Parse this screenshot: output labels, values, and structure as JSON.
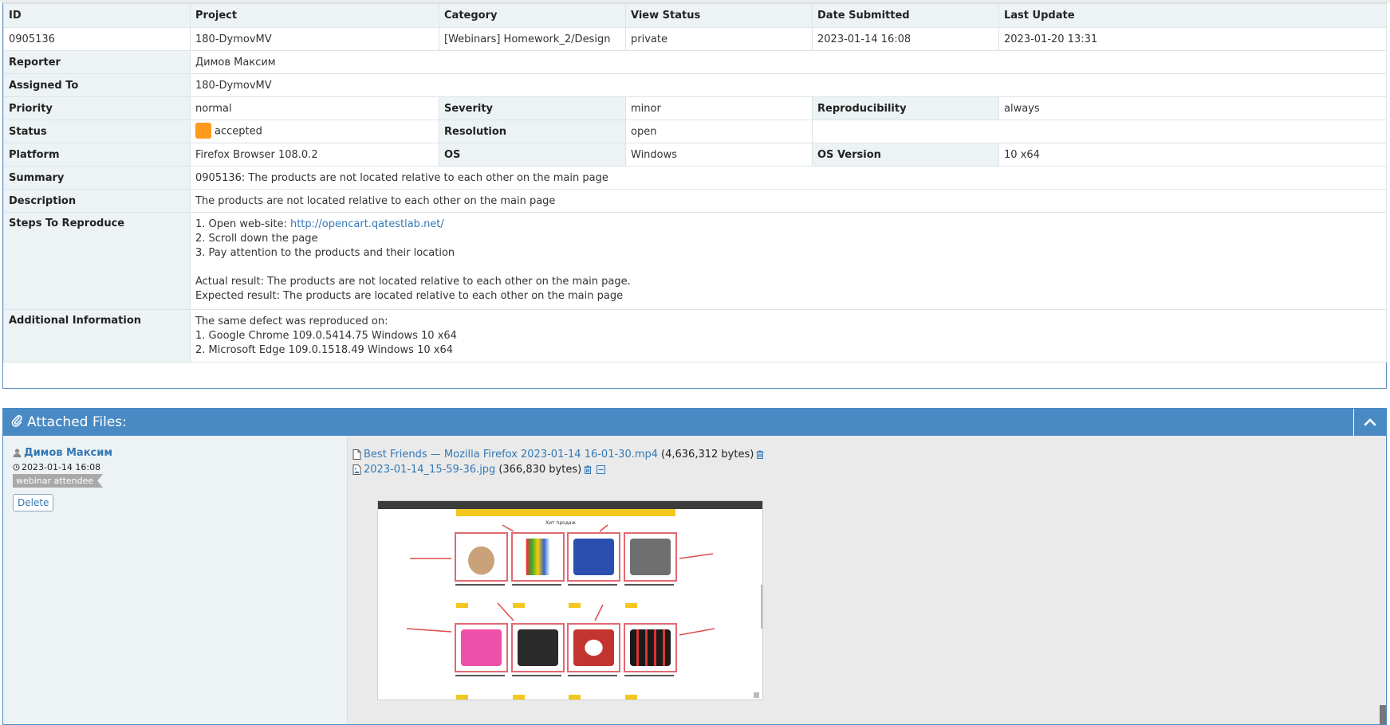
{
  "header": {
    "id_label": "ID",
    "project_label": "Project",
    "category_label": "Category",
    "view_status_label": "View Status",
    "date_submitted_label": "Date Submitted",
    "last_update_label": "Last Update"
  },
  "issue": {
    "id": "0905136",
    "project": "180-DymovMV",
    "category": "[Webinars] Homework_2/Design",
    "view_status": "private",
    "date_submitted": "2023-01-14 16:08",
    "last_update": "2023-01-20 13:31",
    "reporter_label": "Reporter",
    "reporter": "Димов Максим",
    "assigned_label": "Assigned To",
    "assigned_to": "180-DymovMV",
    "priority_label": "Priority",
    "priority": "normal",
    "severity_label": "Severity",
    "severity": "minor",
    "reproducibility_label": "Reproducibility",
    "reproducibility": "always",
    "status_label": "Status",
    "status": "accepted",
    "status_color": "#ff9a1f",
    "resolution_label": "Resolution",
    "resolution": "open",
    "platform_label": "Platform",
    "platform": "Firefox Browser 108.0.2",
    "os_label": "OS",
    "os": "Windows",
    "os_version_label": "OS Version",
    "os_version": "10 x64",
    "summary_label": "Summary",
    "summary": "0905136: The products are not located relative to each other on the main page",
    "description_label": "Description",
    "description": "The products are not located relative to each other on the main page",
    "steps_label": "Steps To Reproduce",
    "steps": {
      "step1_prefix": "1. Open web-site: ",
      "step1_link": "http://opencart.qatestlab.net/",
      "step2": "2. Scroll down the page",
      "step3": "3. Pay attention to the products and their location",
      "actual": "Actual result: The products are not located relative to each other on the main page.",
      "expected": "Expected result: The products are located relative to each other on the main page"
    },
    "additional_label": "Additional Information",
    "additional": {
      "line1": "The same defect was reproduced on:",
      "line2": "1. Google Chrome 109.0.5414.75 Windows 10 x64",
      "line3": "2. Microsoft Edge 109.0.1518.49 Windows 10 x64"
    }
  },
  "attachments": {
    "title": "Attached Files:",
    "author": "Димов Максим",
    "date": "2023-01-14 16:08",
    "tag": "webinar attendee",
    "delete_label": "Delete",
    "files": [
      {
        "name": "Best Friends — Mozilla Firefox 2023-01-14 16-01-30.mp4",
        "size": "(4,636,312 bytes)"
      },
      {
        "name": "2023-01-14_15-59-36.jpg",
        "size": "(366,830 bytes)"
      }
    ],
    "thumbnail_heading": "Хит продаж"
  },
  "colors": {
    "accent": "#4a8ac4",
    "link": "#3378b6",
    "label_bg": "#edf3f4"
  },
  "icons": [
    "paperclip-icon",
    "chevron-up-icon",
    "user-icon",
    "clock-icon",
    "file-icon",
    "image-file-icon",
    "trash-icon",
    "collapse-preview-icon"
  ]
}
